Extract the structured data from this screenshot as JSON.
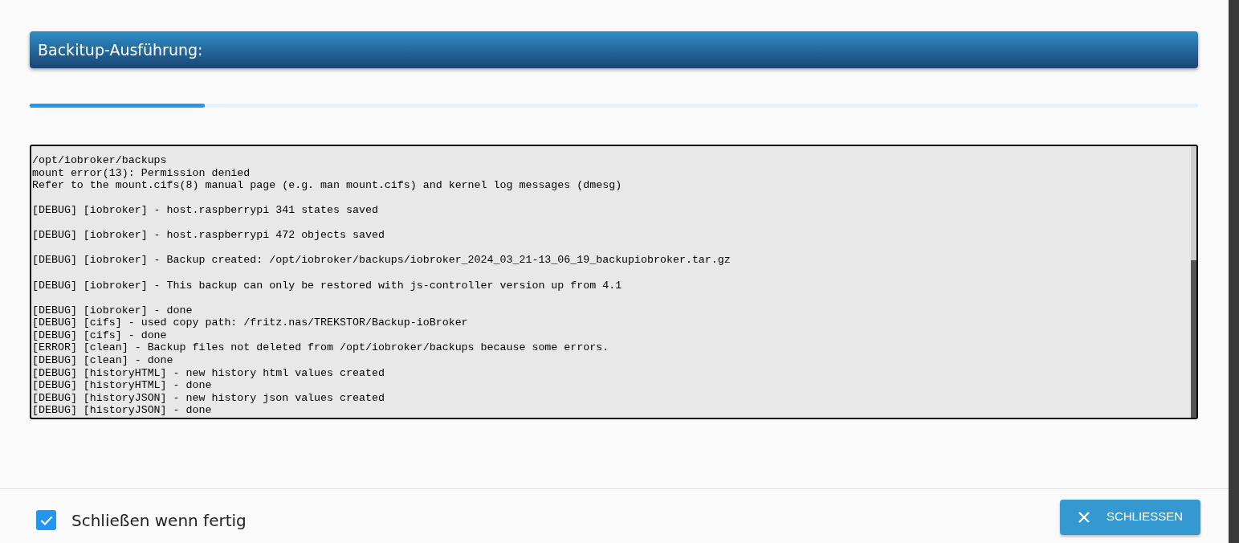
{
  "header": {
    "title": "Backitup-Ausführung:"
  },
  "progress": {
    "level": 0.15
  },
  "log": {
    "blocks": [
      [
        "/opt/iobroker/backups",
        "mount error(13): Permission denied",
        "Refer to the mount.cifs(8) manual page (e.g. man mount.cifs) and kernel log messages (dmesg)"
      ],
      [
        "[DEBUG] [iobroker] - host.raspberrypi 341 states saved"
      ],
      [
        "[DEBUG] [iobroker] - host.raspberrypi 472 objects saved"
      ],
      [
        "[DEBUG] [iobroker] - Backup created: /opt/iobroker/backups/iobroker_2024_03_21-13_06_19_backupiobroker.tar.gz"
      ],
      [
        "[DEBUG] [iobroker] - This backup can only be restored with js-controller version up from 4.1"
      ],
      [
        "[DEBUG] [iobroker] - done",
        "[DEBUG] [cifs] - used copy path: /fritz.nas/TREKSTOR/Backup-ioBroker",
        "[DEBUG] [cifs] - done",
        "[ERROR] [clean] - Backup files not deleted from /opt/iobroker/backups because some errors.",
        "[DEBUG] [clean] - done",
        "[DEBUG] [historyHTML] - new history html values created",
        "[DEBUG] [historyHTML] - done",
        "[DEBUG] [historyJSON] - new history json values created",
        "[DEBUG] [historyJSON] - done"
      ]
    ]
  },
  "footer": {
    "checkbox": {
      "label": "Schließen wenn fertig",
      "checked": true
    },
    "button": {
      "label": "SCHLIESSEN"
    }
  }
}
